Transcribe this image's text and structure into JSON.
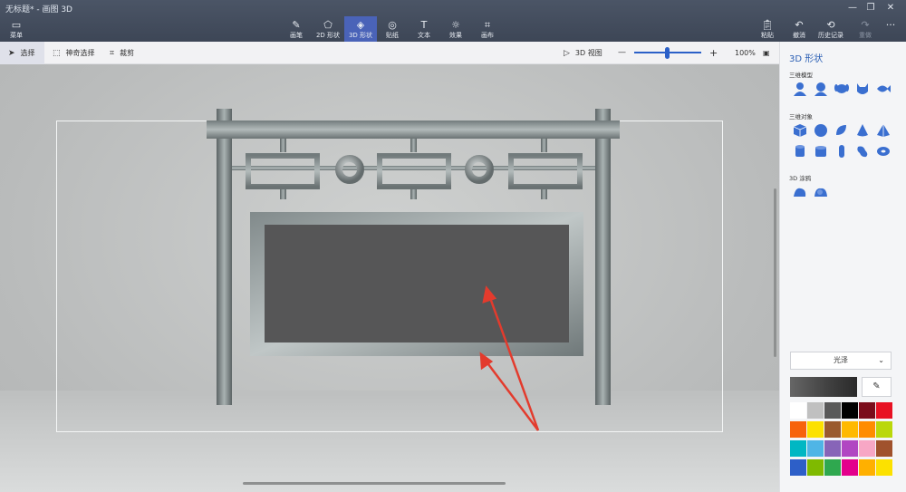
{
  "window": {
    "title": "无标题* - 画图 3D",
    "controls": [
      "—",
      "❐",
      "✕"
    ]
  },
  "ribbon": {
    "menu": {
      "label": "菜单",
      "icon": "folder-icon"
    },
    "tools": [
      {
        "label": "画笔",
        "icon": "brush-icon"
      },
      {
        "label": "2D 形状",
        "icon": "2d-shapes-icon"
      },
      {
        "label": "3D 形状",
        "icon": "3d-shapes-icon"
      },
      {
        "label": "贴纸",
        "icon": "stickers-icon"
      },
      {
        "label": "文本",
        "icon": "text-icon"
      },
      {
        "label": "效果",
        "icon": "effects-icon"
      },
      {
        "label": "画布",
        "icon": "canvas-icon"
      }
    ],
    "active_tool": "3D 形状",
    "right": [
      {
        "label": "粘贴",
        "icon": "paste-icon"
      },
      {
        "label": "撤消",
        "icon": "undo-icon"
      },
      {
        "label": "历史记录",
        "icon": "history-icon"
      },
      {
        "label": "重做",
        "icon": "redo-icon"
      }
    ],
    "more": "···",
    "accent": "#4a63b8"
  },
  "toolbar": {
    "select": "选择",
    "magic_select": "神奇选择",
    "crop": "裁剪",
    "view_3d": "3D 视图",
    "zoom_out": "—",
    "zoom_in": "+",
    "zoom": "100%"
  },
  "panel": {
    "title": "3D 形状",
    "models_label": "三维模型",
    "objects_label": "三维对象",
    "doodles_label": "3D 涂鸦",
    "models": [
      "man-model-icon",
      "woman-model-icon",
      "dog-model-icon",
      "cat-model-icon",
      "fish-model-icon"
    ],
    "objects": [
      "cube-icon",
      "sphere-icon",
      "hemisphere-icon",
      "cone-icon",
      "pyramid-icon",
      "cylinder-icon",
      "tube-icon",
      "capsule-icon",
      "donut-icon",
      "torus-icon"
    ],
    "doodles": [
      "sharp-edge-doodle-icon",
      "soft-edge-doodle-icon"
    ],
    "material": "光泽",
    "eyedropper_icon": "eyedropper-icon",
    "palette": [
      "#ffffff",
      "#c0c0c0",
      "#595959",
      "#000000",
      "#7b0c1b",
      "#e81123",
      "#f7630c",
      "#fce100",
      "#9a5a2e",
      "#ffb900",
      "#ff8c00",
      "#bad80a",
      "#00b7c3",
      "#4fb5e6",
      "#8764b8",
      "#b146c2",
      "#f7a7c5",
      "#a0522d",
      "#2d5fc8",
      "#7fba00",
      "#2fa84f",
      "#e3008c",
      "#ffb000",
      "#fce100"
    ]
  }
}
